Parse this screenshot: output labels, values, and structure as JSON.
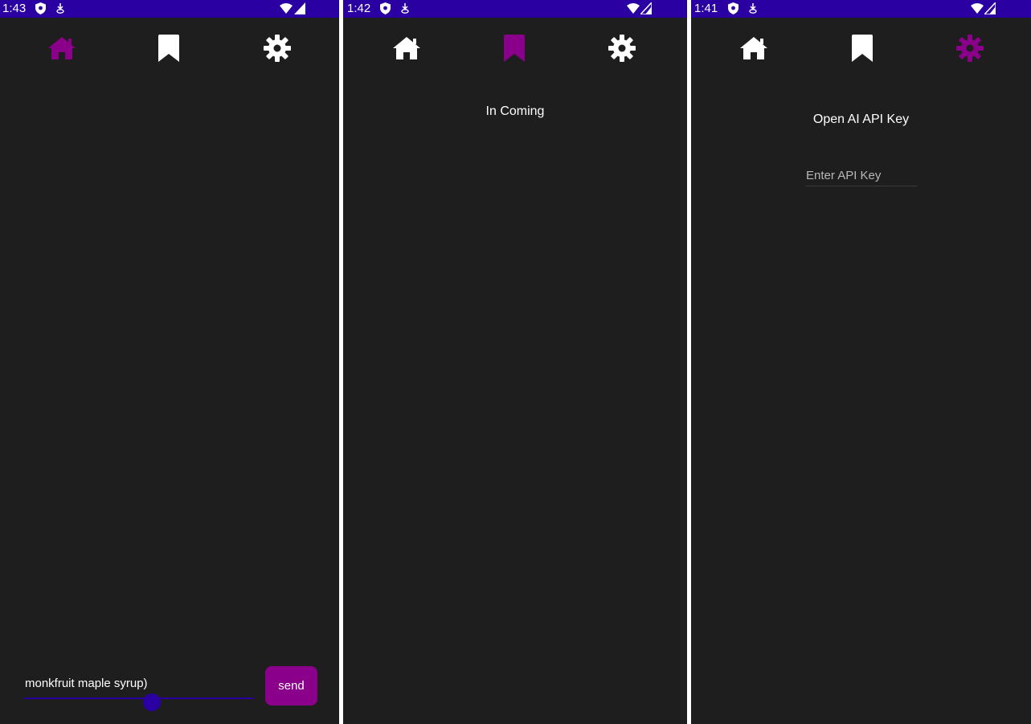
{
  "colors": {
    "status_bar": "#2a00a3",
    "background": "#1e1e1e",
    "accent": "#8b008b",
    "icon_default": "#ffffff",
    "slider": "#2a00a3"
  },
  "screens": [
    {
      "id": "home",
      "status_time": "1:43",
      "active_tab": "home"
    },
    {
      "id": "bookmarks",
      "status_time": "1:42",
      "active_tab": "bookmarks"
    },
    {
      "id": "settings",
      "status_time": "1:41",
      "active_tab": "settings"
    }
  ],
  "nav_icons": [
    "home-icon",
    "bookmark-icon",
    "gear-icon"
  ],
  "home": {
    "input_text": "monkfruit maple syrup)",
    "send_label": "send"
  },
  "bookmarks": {
    "message": "In Coming"
  },
  "settings": {
    "title": "Open AI API Key",
    "api_key_placeholder": "Enter API Key",
    "api_key_value": ""
  }
}
